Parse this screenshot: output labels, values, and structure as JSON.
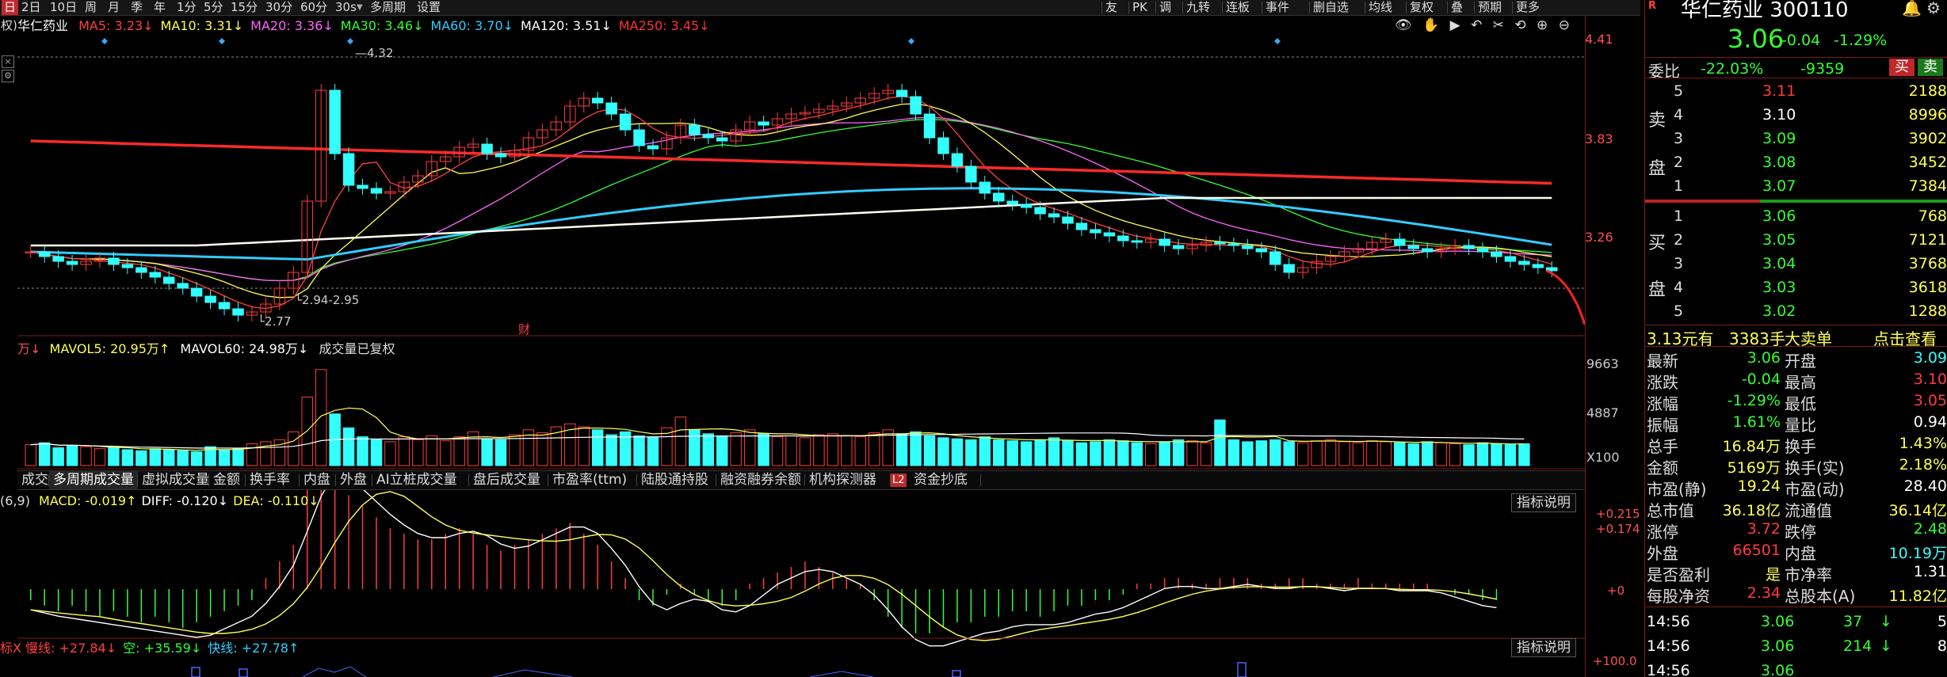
{
  "toolbar": {
    "periods": [
      "日",
      "2日",
      "10日",
      "周",
      "月",
      "季",
      "年",
      "1分",
      "5分",
      "15分",
      "30分",
      "60分",
      "30s",
      "多周期",
      "设置"
    ],
    "right_items": [
      "友",
      "PK",
      "调",
      "九转",
      "连板",
      "事件",
      "删自选",
      "均线",
      "复权",
      "叠",
      "预期",
      "更多"
    ]
  },
  "stock": {
    "name": "华仁药业",
    "code": "300110",
    "title": "华仁药业 300110"
  },
  "ma_legend": [
    {
      "text": "MA5: 3.23↓",
      "color": "#ff4040"
    },
    {
      "text": "MA10: 3.31↓",
      "color": "#ffff55"
    },
    {
      "text": "MA20: 3.36↓",
      "color": "#ff66ff"
    },
    {
      "text": "MA30: 3.46↓",
      "color": "#33ff33"
    },
    {
      "text": "MA60: 3.70↓",
      "color": "#33ccff"
    },
    {
      "text": "MA120: 3.51↓",
      "color": "#ffffff"
    },
    {
      "text": "MA250: 3.45↓",
      "color": "#ff3333"
    }
  ],
  "price_axis": [
    "4.41",
    "3.83",
    "3.26"
  ],
  "chart_labels": {
    "high": "4.32",
    "low": "2.77",
    "range": "2.94-2.95",
    "fin": "财"
  },
  "chart_data": [
    {
      "type": "line",
      "title": "华仁药业 K线",
      "xlabel": "",
      "ylabel": "",
      "ylim": [
        2.7,
        4.45
      ],
      "series": [
        {
          "name": "MA5",
          "values": [
            3.23
          ]
        },
        {
          "name": "MA10",
          "values": [
            3.31
          ]
        },
        {
          "name": "MA20",
          "values": [
            3.36
          ]
        },
        {
          "name": "MA30",
          "values": [
            3.46
          ]
        },
        {
          "name": "MA60",
          "values": [
            3.7
          ]
        },
        {
          "name": "MA120",
          "values": [
            3.51
          ]
        },
        {
          "name": "MA250",
          "values": [
            3.45
          ]
        }
      ],
      "close": [
        3.18,
        3.15,
        3.12,
        3.1,
        3.12,
        3.14,
        3.1,
        3.08,
        3.05,
        3.02,
        2.98,
        2.95,
        2.9,
        2.86,
        2.82,
        2.78,
        2.8,
        2.85,
        2.95,
        3.05,
        3.5,
        4.2,
        3.8,
        3.6,
        3.58,
        3.55,
        3.56,
        3.62,
        3.66,
        3.75,
        3.78,
        3.84,
        3.86,
        3.8,
        3.78,
        3.82,
        3.9,
        3.95,
        4.0,
        4.1,
        4.15,
        4.12,
        4.05,
        3.95,
        3.85,
        3.83,
        3.9,
        3.98,
        3.92,
        3.9,
        3.88,
        3.95,
        4.0,
        3.98,
        4.02,
        4.05,
        4.06,
        4.08,
        4.1,
        4.12,
        4.15,
        4.18,
        4.2,
        4.16,
        4.05,
        3.9,
        3.8,
        3.72,
        3.62,
        3.55,
        3.5,
        3.48,
        3.46,
        3.42,
        3.4,
        3.36,
        3.32,
        3.3,
        3.28,
        3.25,
        3.24,
        3.26,
        3.22,
        3.2,
        3.22,
        3.24,
        3.23,
        3.22,
        3.2,
        3.18,
        3.1,
        3.05,
        3.08,
        3.12,
        3.15,
        3.18,
        3.2,
        3.24,
        3.26,
        3.22,
        3.2,
        3.18,
        3.2,
        3.22,
        3.2,
        3.18,
        3.15,
        3.12,
        3.1,
        3.08,
        3.06
      ]
    },
    {
      "type": "bar",
      "title": "成交量",
      "legend": [
        "MAVOL5: 20.95万↑",
        "MAVOL60: 24.98万↓",
        "成交量已复权"
      ],
      "ylim": [
        0,
        11000
      ],
      "ticks": [
        "9663",
        "4887",
        "X100"
      ],
      "values": [
        2100,
        2300,
        1800,
        2000,
        1900,
        1700,
        1800,
        1600,
        1500,
        1700,
        1600,
        1500,
        1400,
        1900,
        1600,
        1700,
        2200,
        2400,
        2600,
        3400,
        6900,
        9663,
        5200,
        3800,
        2900,
        2600,
        2400,
        2900,
        2600,
        3000,
        2500,
        2900,
        3400,
        2700,
        2600,
        3100,
        3600,
        3300,
        3900,
        4200,
        3900,
        3600,
        3100,
        3400,
        3000,
        2900,
        3800,
        4887,
        3600,
        3200,
        3000,
        3300,
        3600,
        3200,
        2900,
        3000,
        2800,
        3100,
        3200,
        3000,
        2900,
        3300,
        3600,
        3200,
        3400,
        3000,
        2800,
        2700,
        2600,
        2900,
        2600,
        2500,
        2400,
        2600,
        2800,
        2500,
        2300,
        2400,
        2600,
        2500,
        2300,
        2200,
        2400,
        2600,
        2500,
        2300,
        4600,
        2600,
        2400,
        2500,
        2600,
        2400,
        2300,
        2500,
        2600,
        2400,
        2300,
        2500,
        2400,
        2300,
        2200,
        2400,
        2300,
        2200,
        2100,
        2300,
        2200,
        2100,
        2200
      ]
    },
    {
      "type": "bar",
      "title": "MACD",
      "legend": [
        "MACD: -0.019↑",
        "DIFF: -0.120↓",
        "DEA: -0.110↓"
      ],
      "ticks": [
        "+0.215",
        "+0.174",
        "+0"
      ],
      "values": [
        -0.02,
        -0.03,
        -0.04,
        -0.03,
        -0.04,
        -0.05,
        -0.04,
        -0.05,
        -0.06,
        -0.05,
        -0.06,
        -0.07,
        -0.06,
        -0.05,
        -0.04,
        -0.03,
        -0.02,
        0.02,
        0.05,
        0.08,
        0.18,
        0.215,
        0.19,
        0.17,
        0.15,
        0.13,
        0.11,
        0.1,
        0.09,
        0.09,
        0.1,
        0.11,
        0.1,
        0.08,
        0.07,
        0.08,
        0.09,
        0.1,
        0.11,
        0.12,
        0.1,
        0.08,
        0.05,
        0.02,
        -0.02,
        -0.03,
        -0.01,
        0.01,
        -0.01,
        -0.02,
        -0.03,
        -0.02,
        0.01,
        0.02,
        0.03,
        0.04,
        0.05,
        0.04,
        0.03,
        0.02,
        0.01,
        -0.02,
        -0.05,
        -0.07,
        -0.08,
        -0.08,
        -0.07,
        -0.06,
        -0.06,
        -0.05,
        -0.05,
        -0.04,
        -0.04,
        -0.05,
        -0.04,
        -0.03,
        -0.03,
        -0.02,
        -0.02,
        -0.01,
        0.01,
        0.01,
        0.02,
        0.02,
        0.01,
        0.01,
        0.02,
        0.02,
        0.02,
        0.01,
        0.01,
        0.02,
        0.02,
        0.01,
        0.01,
        0.01,
        0.02,
        0.01,
        0.01,
        0.01,
        0.01,
        0.01,
        0.0,
        -0.01,
        -0.01,
        -0.02,
        -0.02
      ]
    }
  ],
  "vol_tabs": [
    "成交量",
    "多周期成交量",
    "虚拟成交量",
    "金额",
    "换手率",
    "内盘",
    "外盘",
    "AI立桩成交量",
    "盘后成交量",
    "市盈率(ttm)",
    "陆股通持股",
    "融资融券余额",
    "机构探测器",
    "资金抄底"
  ],
  "vol_tab_selected": "多周期成交量",
  "vol_tab_l2": "L2",
  "macd_params": "(6,9)",
  "macd_legend": [
    {
      "text": "MACD: -0.019↑",
      "color": "#ffff55"
    },
    {
      "text": "DIFF: -0.120↓",
      "color": "#ffffff"
    },
    {
      "text": "DEA: -0.110↓",
      "color": "#ffff55"
    }
  ],
  "indicator_info_button": "指标说明",
  "bottom_legend": [
    {
      "text": "标X 慢线: +27.84↓",
      "color": "#ff4040"
    },
    {
      "text": "空: +35.59↓",
      "color": "#33ff33"
    },
    {
      "text": "快线: +27.78↑",
      "color": "#33ccff"
    }
  ],
  "bottom_axis": "+100.0",
  "vol_legend_prefix": "万↓",
  "quote": {
    "price": "3.06",
    "change": "-0.04",
    "pct": "-1.29%",
    "weibi_label": "委比",
    "weibi": "-22.03%",
    "weicha": "-9359",
    "buy_btn": "买",
    "sell_btn": "卖",
    "sell_label": [
      "卖",
      "盘"
    ],
    "buy_label": [
      "买",
      "盘"
    ],
    "asks": [
      {
        "lv": "5",
        "price": "3.11",
        "vol": "2188"
      },
      {
        "lv": "4",
        "price": "3.10",
        "vol": "8996"
      },
      {
        "lv": "3",
        "price": "3.09",
        "vol": "3902"
      },
      {
        "lv": "2",
        "price": "3.08",
        "vol": "3452"
      },
      {
        "lv": "1",
        "price": "3.07",
        "vol": "7384"
      }
    ],
    "bids": [
      {
        "lv": "1",
        "price": "3.06",
        "vol": "768"
      },
      {
        "lv": "2",
        "price": "3.05",
        "vol": "7121"
      },
      {
        "lv": "3",
        "price": "3.04",
        "vol": "3768"
      },
      {
        "lv": "4",
        "price": "3.03",
        "vol": "3618"
      },
      {
        "lv": "5",
        "price": "3.02",
        "vol": "1288"
      }
    ],
    "big_order": {
      "price": "3.13元有",
      "size": "3383手",
      "label": "大卖单",
      "link": "点击查看"
    },
    "stats": [
      [
        "最新",
        "3.06",
        "开盘",
        "3.09"
      ],
      [
        "涨跌",
        "-0.04",
        "最高",
        "3.10"
      ],
      [
        "涨幅",
        "-1.29%",
        "最低",
        "3.05"
      ],
      [
        "振幅",
        "1.61%",
        "量比",
        "0.94"
      ],
      [
        "总手",
        "16.84万",
        "换手",
        "1.43%"
      ],
      [
        "金额",
        "5169万",
        "换手(实)",
        "2.18%"
      ],
      [
        "市盈(静)",
        "19.24",
        "市盈(动)",
        "28.40"
      ],
      [
        "总市值",
        "36.18亿",
        "流通值",
        "36.14亿"
      ],
      [
        "涨停",
        "3.72",
        "跌停",
        "2.48"
      ],
      [
        "外盘",
        "66501",
        "内盘",
        "10.19万"
      ],
      [
        "是否盈利",
        "是",
        "市净率",
        "1.31"
      ],
      [
        "每股净资",
        "2.34",
        "总股本(A)",
        "11.82亿"
      ]
    ],
    "ticks": [
      {
        "time": "14:56",
        "price": "3.06",
        "vol": "37",
        "dir": "down",
        "n": "5"
      },
      {
        "time": "14:56",
        "price": "3.06",
        "vol": "214",
        "dir": "down",
        "n": "8"
      },
      {
        "time": "14:56",
        "price": "3.06",
        "vol": "",
        "dir": "",
        "n": ""
      }
    ]
  },
  "colors": {
    "up": "#ff3c3c",
    "down": "#33ffff",
    "yellow": "#ffff55",
    "green": "#33ff33"
  }
}
